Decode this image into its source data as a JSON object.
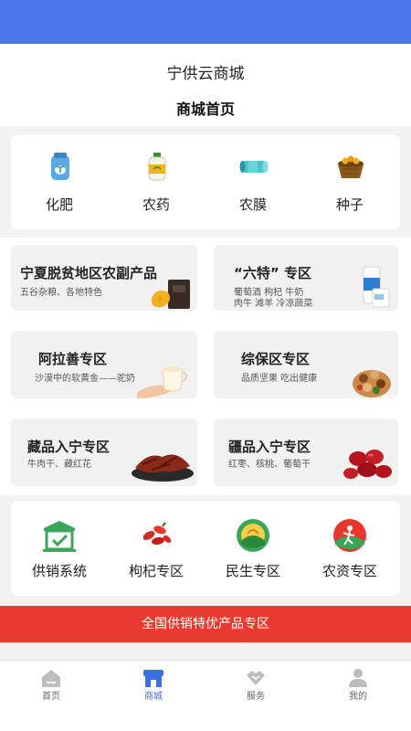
{
  "header": {
    "app_title": "宁供云商城",
    "page_title": "商城首页"
  },
  "categories": [
    {
      "label": "化肥",
      "icon": "fertilizer-bag-icon"
    },
    {
      "label": "农药",
      "icon": "pesticide-bottle-icon"
    },
    {
      "label": "农膜",
      "icon": "film-roll-icon"
    },
    {
      "label": "种子",
      "icon": "seed-basket-icon"
    }
  ],
  "zones": [
    {
      "title": "宁夏脱贫地区农副产品",
      "subtitle": "五谷杂粮、各地特色",
      "subtitle2": ""
    },
    {
      "title": "“六特” 专区",
      "subtitle": "葡萄酒 枸杞 牛奶",
      "subtitle2": "肉牛 滩羊 冷凉蔬菜"
    },
    {
      "title": "阿拉善专区",
      "subtitle": "沙漠中的软黄金——驼奶",
      "subtitle2": ""
    },
    {
      "title": "综保区专区",
      "subtitle": "品质坚果 吃出健康",
      "subtitle2": ""
    },
    {
      "title": "藏品入宁专区",
      "subtitle": "牛肉干、藏红花",
      "subtitle2": ""
    },
    {
      "title": "疆品入宁专区",
      "subtitle": "红枣、核桃、葡萄干",
      "subtitle2": ""
    }
  ],
  "services": [
    {
      "label": "供销系统",
      "icon": "supply-store-icon"
    },
    {
      "label": "枸杞专区",
      "icon": "goji-berry-icon"
    },
    {
      "label": "民生专区",
      "icon": "livelihood-emblem-icon"
    },
    {
      "label": "农资专区",
      "icon": "farm-supply-emblem-icon"
    }
  ],
  "promo": {
    "label": "全国供销特优产品专区"
  },
  "tabs": [
    {
      "label": "首页",
      "icon": "home-icon",
      "active": false
    },
    {
      "label": "商城",
      "icon": "shop-icon",
      "active": true
    },
    {
      "label": "服务",
      "icon": "handshake-icon",
      "active": false
    },
    {
      "label": "我的",
      "icon": "user-icon",
      "active": false
    }
  ],
  "colors": {
    "status_bar": "#4a78ea",
    "promo": "#e83a2e",
    "tab_active": "#3a6fe6",
    "tab_inactive": "#bdbdbd"
  }
}
